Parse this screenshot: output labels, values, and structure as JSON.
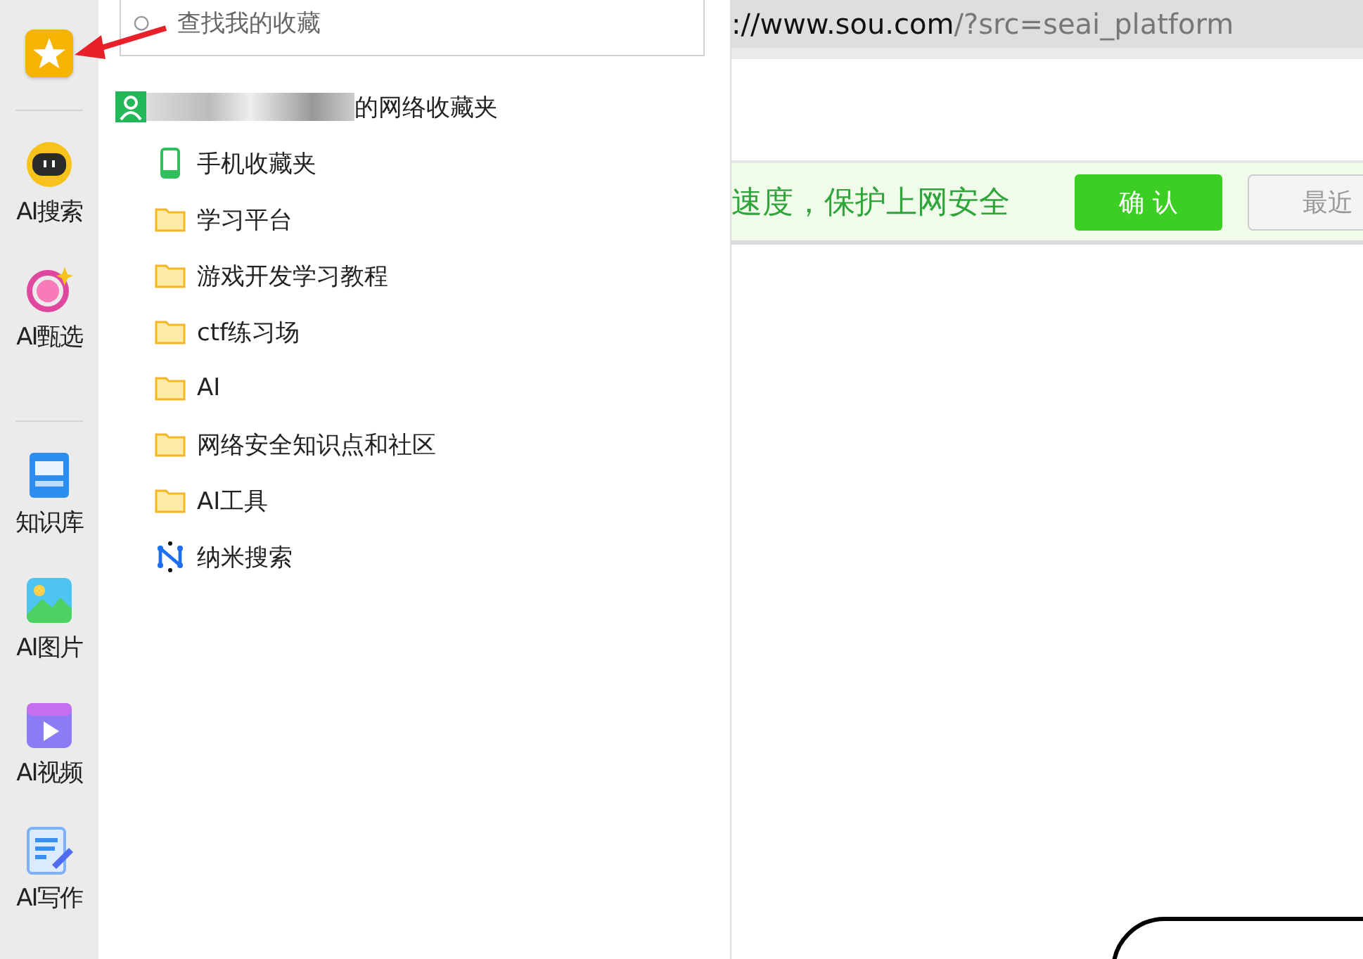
{
  "sidebar": {
    "items": [
      {
        "kind": "favorites",
        "selected": true
      },
      {
        "kind": "divider"
      },
      {
        "kind": "robot",
        "label": "AI搜索",
        "selected": false
      },
      {
        "kind": "ai-ring",
        "label": "AI甄选",
        "selected": false
      },
      {
        "kind": "divider"
      },
      {
        "kind": "book",
        "label": "知识库",
        "selected": false
      },
      {
        "kind": "image",
        "label": "AI图片",
        "selected": false
      },
      {
        "kind": "video",
        "label": "AI视频",
        "selected": false
      },
      {
        "kind": "write",
        "label": "AI写作",
        "selected": false
      }
    ]
  },
  "favorites_panel": {
    "search": {
      "placeholder": "查找我的收藏"
    },
    "account": {
      "label": "的网络收藏夹"
    },
    "items": [
      {
        "kind": "phone",
        "label": "手机收藏夹"
      },
      {
        "kind": "folder",
        "label": "学习平台"
      },
      {
        "kind": "folder",
        "label": "游戏开发学习教程"
      },
      {
        "kind": "folder",
        "label": "ctf练习场"
      },
      {
        "kind": "folder",
        "label": "AI"
      },
      {
        "kind": "folder",
        "label": "网络安全知识点和社区"
      },
      {
        "kind": "folder",
        "label": "AI工具"
      },
      {
        "kind": "nano",
        "label": "纳米搜索"
      }
    ]
  },
  "address_bar": {
    "url_host": "://www.sou.com",
    "url_rest": "/?src=seai_platform"
  },
  "banner": {
    "text": "速度，保护上网安全",
    "confirm_button": "确 认",
    "other_button": "最近"
  }
}
